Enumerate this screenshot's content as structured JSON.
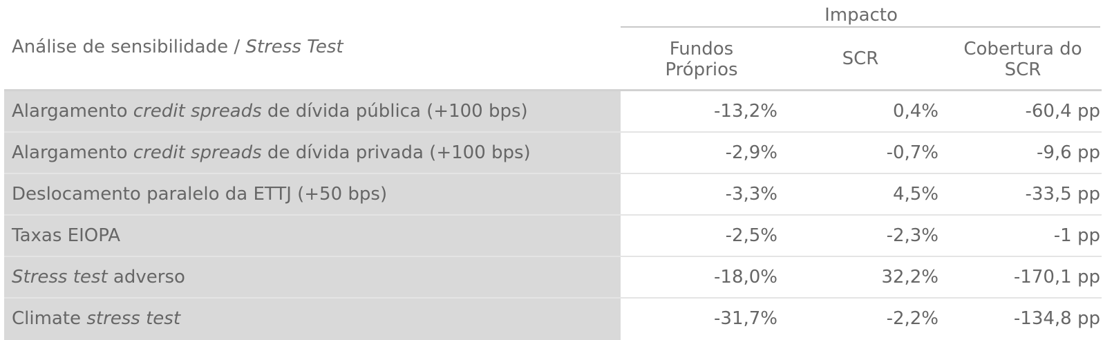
{
  "header": {
    "impact_title": "Impacto",
    "label_plain": "Análise de sensibilidade / ",
    "label_italic": "Stress Test",
    "col_own_funds_line1": "Fundos",
    "col_own_funds_line2": "Próprios",
    "col_scr": "SCR",
    "col_coverage_line1": "Cobertura do",
    "col_coverage_line2": "SCR"
  },
  "rows": [
    {
      "label_pre": "Alargamento ",
      "label_italic": "credit spreads",
      "label_post": " de dívida pública (+100 bps)",
      "own_funds": "-13,2%",
      "scr": "0,4%",
      "coverage": "-60,4 pp"
    },
    {
      "label_pre": "Alargamento ",
      "label_italic": "credit spreads",
      "label_post": " de dívida privada (+100 bps)",
      "own_funds": "-2,9%",
      "scr": "-0,7%",
      "coverage": "-9,6 pp"
    },
    {
      "label_pre": "Deslocamento paralelo da ETTJ (+50 bps)",
      "label_italic": "",
      "label_post": "",
      "own_funds": "-3,3%",
      "scr": "4,5%",
      "coverage": "-33,5 pp"
    },
    {
      "label_pre": "Taxas EIOPA",
      "label_italic": "",
      "label_post": "",
      "own_funds": "-2,5%",
      "scr": "-2,3%",
      "coverage": "-1 pp"
    },
    {
      "label_pre": "",
      "label_italic": "Stress test",
      "label_post": " adverso",
      "own_funds": "-18,0%",
      "scr": "32,2%",
      "coverage": "-170,1 pp"
    },
    {
      "label_pre": "Climate ",
      "label_italic": "stress test",
      "label_post": "",
      "own_funds": "-31,7%",
      "scr": "-2,2%",
      "coverage": "-134,8 pp"
    }
  ]
}
